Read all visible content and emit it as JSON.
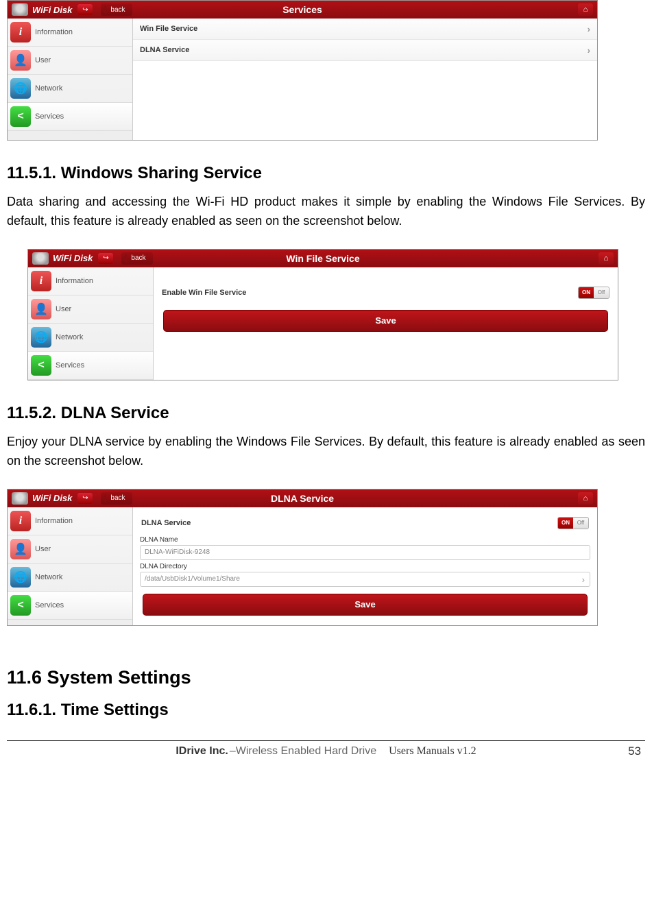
{
  "screenshots": {
    "s1": {
      "brand": "WiFi Disk",
      "back": "back",
      "title": "Services",
      "sidebar": [
        "Information",
        "User",
        "Network",
        "Services"
      ],
      "rows": [
        "Win File Service",
        "DLNA Service"
      ]
    },
    "s2": {
      "brand": "WiFi Disk",
      "back": "back",
      "title": "Win File Service",
      "sidebar": [
        "Information",
        "User",
        "Network",
        "Services"
      ],
      "enable_label": "Enable Win File Service",
      "toggle_on": "ON",
      "toggle_off": "Off",
      "save": "Save"
    },
    "s3": {
      "brand": "WiFi Disk",
      "back": "back",
      "title": "DLNA Service",
      "sidebar": [
        "Information",
        "User",
        "Network",
        "Services"
      ],
      "svc_label": "DLNA Service",
      "toggle_on": "ON",
      "toggle_off": "Off",
      "name_label": "DLNA Name",
      "name_value": "DLNA-WiFiDisk-9248",
      "dir_label": "DLNA Directory",
      "dir_value": "/data/UsbDisk1/Volume1/Share",
      "save": "Save"
    }
  },
  "sections": {
    "h1151": "11.5.1. Windows Sharing Service",
    "p1151": "Data sharing and accessing the Wi-Fi HD product makes it simple by enabling the Windows File Services. By default, this feature is already enabled as seen on the screenshot below.",
    "h1152": "11.5.2. DLNA Service",
    "p1152": "Enjoy your DLNA service by enabling the Windows File Services.  By default, this feature is already enabled as seen on the screenshot below.",
    "h116": "11.6 System Settings",
    "h1161": "11.6.1. Time Settings"
  },
  "footer": {
    "company": "IDrive Inc.",
    "prod": "–Wireless Enabled Hard Drive",
    "doc": "Users Manuals v1.2",
    "page": "53"
  }
}
